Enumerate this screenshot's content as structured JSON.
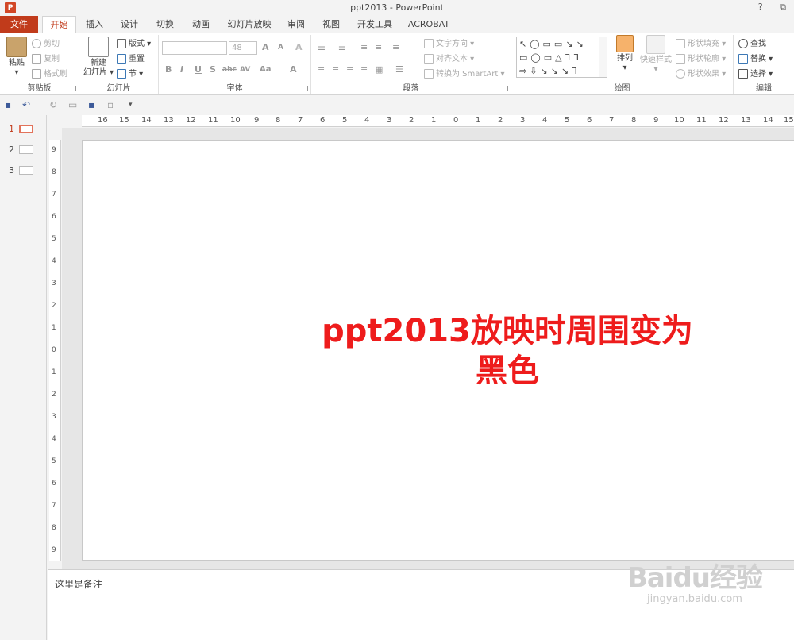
{
  "window": {
    "title": "ppt2013 - PowerPoint",
    "help": "?",
    "restore": "⧉",
    "app_icon": "P"
  },
  "tabs": [
    "文件",
    "开始",
    "插入",
    "设计",
    "切换",
    "动画",
    "幻灯片放映",
    "审阅",
    "视图",
    "开发工具",
    "ACROBAT"
  ],
  "ribbon": {
    "clipboard": {
      "label": "剪贴板",
      "paste": "粘贴",
      "cut": "剪切",
      "copy": "复制",
      "format_painter": "格式刷"
    },
    "slides": {
      "label": "幻灯片",
      "new_slide_1": "新建",
      "new_slide_2": "幻灯片",
      "layout": "版式",
      "reset": "重置",
      "section": "节"
    },
    "font": {
      "label": "字体",
      "font_name": "",
      "font_size": "48",
      "bold": "B",
      "italic": "I",
      "underline": "U",
      "shadow": "S",
      "strike": "abc",
      "spacing": "AV",
      "case": "Aa",
      "grow": "A",
      "shrink": "A",
      "clear": "A",
      "color": "A"
    },
    "paragraph": {
      "label": "段落",
      "text_direction": "文字方向",
      "align_text": "对齐文本",
      "smartart": "转换为 SmartArt"
    },
    "drawing": {
      "label": "绘图",
      "arrange": "排列",
      "quick_styles": "快速样式",
      "shape_fill": "形状填充",
      "shape_outline": "形状轮廓",
      "shape_effects": "形状效果",
      "shapes_row1": "↖◯▭▭↘↘",
      "shapes_row2": "▭◯▭△ᒣᒣ",
      "shapes_row3": "⇨⇩↘↘↘ᒣ"
    },
    "editing": {
      "label": "编辑",
      "find": "查找",
      "replace": "替换",
      "select": "选择"
    }
  },
  "ruler": {
    "h": [
      "16",
      "15",
      "14",
      "13",
      "12",
      "11",
      "10",
      "9",
      "8",
      "7",
      "6",
      "5",
      "4",
      "3",
      "2",
      "1",
      "0",
      "1",
      "2",
      "3",
      "4",
      "5",
      "6",
      "7",
      "8",
      "9",
      "10",
      "11",
      "12",
      "13",
      "14",
      "15"
    ],
    "v": [
      "9",
      "8",
      "7",
      "6",
      "5",
      "4",
      "3",
      "2",
      "1",
      "0",
      "1",
      "2",
      "3",
      "4",
      "5",
      "6",
      "7",
      "8",
      "9"
    ]
  },
  "thumbnails": [
    "1",
    "2",
    "3"
  ],
  "slide": {
    "title_line1": "ppt2013放映时周围变为",
    "title_line2": "黑色"
  },
  "notes": {
    "text": "这里是备注"
  },
  "watermark": {
    "logo": "Baidu经验",
    "url": "jingyan.baidu.com"
  },
  "colors": {
    "accent": "#c13b1b",
    "title_red": "#ee1c1c"
  }
}
